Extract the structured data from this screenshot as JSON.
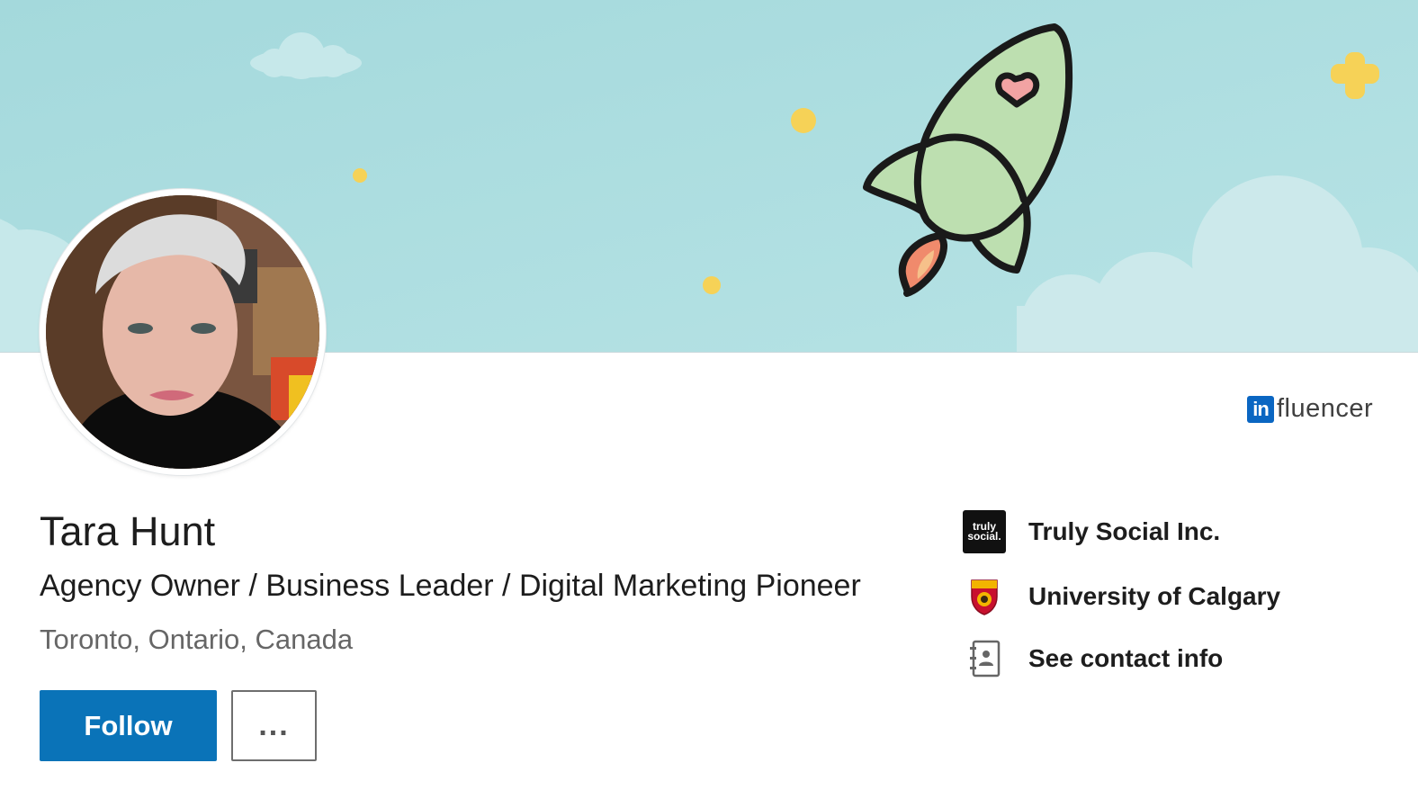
{
  "profile": {
    "name": "Tara Hunt",
    "headline": "Agency Owner / Business Leader / Digital Marketing Pioneer",
    "location": "Toronto, Ontario, Canada"
  },
  "badge": {
    "in_text": "in",
    "word": "fluencer"
  },
  "actions": {
    "follow_label": "Follow",
    "more_label": "..."
  },
  "sidebar": {
    "items": [
      {
        "label": "Truly Social Inc.",
        "icon": "truly-social-logo",
        "logo_text_1": "truly",
        "logo_text_2": "social."
      },
      {
        "label": "University of Calgary",
        "icon": "university-crest-logo"
      },
      {
        "label": "See contact info",
        "icon": "contact-card-icon"
      }
    ]
  },
  "colors": {
    "banner": "#a9dcdf",
    "follow_button": "#0a73b8",
    "rocket_body": "#bddfb0",
    "star_yellow": "#f6d257"
  }
}
